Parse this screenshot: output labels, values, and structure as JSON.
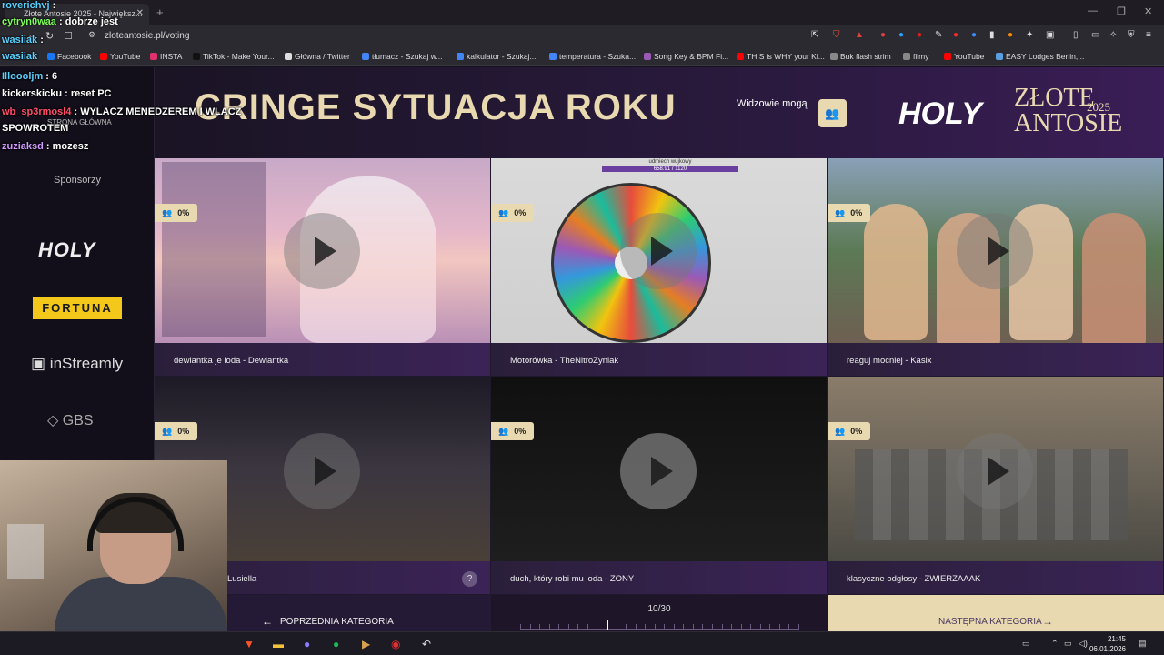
{
  "browser": {
    "tab_title": "Złote Antosie 2025 - Największ...",
    "url": "zloteantosie.pl/voting",
    "bookmarks": [
      {
        "label": "Facebook",
        "color": "#1877f2"
      },
      {
        "label": "YouTube",
        "color": "#ff0000"
      },
      {
        "label": "INSTA",
        "color": "#e1306c"
      },
      {
        "label": "TikTok - Make Your...",
        "color": "#111111"
      },
      {
        "label": "Główna / Twitter",
        "color": "#dddddd"
      },
      {
        "label": "tłumacz - Szukaj w...",
        "color": "#4285f4"
      },
      {
        "label": "kalkulator - Szukaj...",
        "color": "#4285f4"
      },
      {
        "label": "temperatura - Szuka...",
        "color": "#4285f4"
      },
      {
        "label": "Song Key & BPM Fi...",
        "color": "#9b59b6"
      },
      {
        "label": "THIS is WHY your Kl...",
        "color": "#ff0000"
      },
      {
        "label": "Buk flash strim",
        "color": "#888888"
      },
      {
        "label": "filmy",
        "color": "#888888"
      },
      {
        "label": "YouTube",
        "color": "#ff0000"
      },
      {
        "label": "EASY Lodges Berlin,...",
        "color": "#5aa0e0"
      }
    ]
  },
  "chat": [
    {
      "user": "roverichvj",
      "text": " :",
      "color": "#5ad1ff"
    },
    {
      "user": "cytryn0waa",
      "text": " : dobrze jest",
      "color": "#7dff5a"
    },
    {
      "user": "wasiiak",
      "text": " :",
      "color": "#5ad1ff"
    },
    {
      "user": "wasiiak",
      "text": "",
      "color": "#5ad1ff"
    },
    {
      "user": "Illoooljm",
      "text": " : 6",
      "color": "#5ad1ff"
    },
    {
      "user": "kickerskicku",
      "text": " : reset PC",
      "color": "#ffffff"
    },
    {
      "user": "wb_sp3rmosl4",
      "text": " : WYLACZ MENEDZEREM I WLACZ",
      "color": "#ff4d6a"
    },
    {
      "user": "",
      "text": "SPOWROTEM",
      "color": "#ffffff"
    },
    {
      "user": "zuziaksd",
      "text": " : mozesz",
      "color": "#cf9bff"
    }
  ],
  "page": {
    "category_title": "CRINGE SYTUACJA ROKU",
    "viewers_label": "Widzowie mogą",
    "sidebar_home": "STRONA GŁÓWNA",
    "sponsors_label": "Sponsorzy",
    "sponsors": [
      "HOLY",
      "FORTUNA",
      "inStreamly",
      "GBS"
    ],
    "brand": {
      "holy": "HOLY",
      "zlote": "ZŁOTE",
      "antosie": "ANTOSIE",
      "year": "2025"
    },
    "accent": "#e9d9b0",
    "candidates": [
      {
        "title": "dewiantka je loda - Dewiantka",
        "percent": "0%",
        "thumb": "anime"
      },
      {
        "title": "Motorówka - TheNitroZyniak",
        "percent": "0%",
        "thumb": "wheel",
        "overlay_text": "udmiech wujkowy",
        "overlay_counter": "658.91 / 1120"
      },
      {
        "title": "reaguj mocniej - Kasix",
        "percent": "0%",
        "thumb": "people"
      },
      {
        "title": "Lusiella",
        "percent": "0%",
        "thumb": "night-square",
        "help": "?"
      },
      {
        "title": "duch, który robi mu loda - ZONY",
        "percent": "0%",
        "thumb": "dark"
      },
      {
        "title": "klasyczne odgłosy - ZWIERZAAAK",
        "percent": "0%",
        "thumb": "minecraft"
      }
    ],
    "prev_label": "POPRZEDNIA KATEGORIA",
    "next_label": "NASTĘPNA KATEGORIA",
    "progress_label": "10/30",
    "progress_current": 10,
    "progress_total": 30
  },
  "taskbar": {
    "time": "21:45",
    "date": "06.01.2026"
  }
}
